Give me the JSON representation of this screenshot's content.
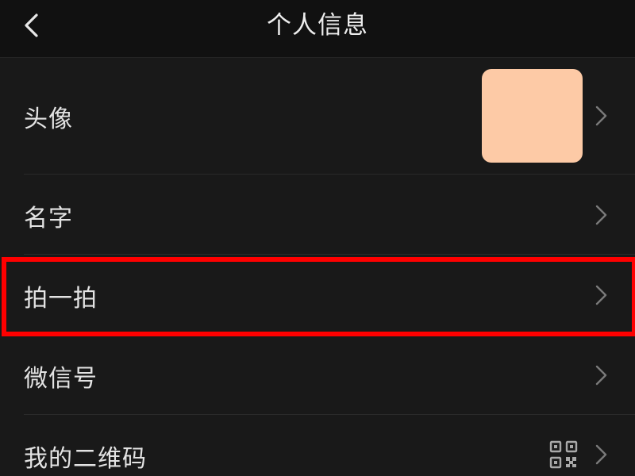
{
  "header": {
    "title": "个人信息",
    "back_icon": "chevron-left-icon"
  },
  "rows": [
    {
      "label": "头像",
      "trailing": "avatar-image"
    },
    {
      "label": "名字",
      "trailing": "chevron-right-icon"
    },
    {
      "label": "拍一拍",
      "trailing": "chevron-right-icon",
      "highlighted": true
    },
    {
      "label": "微信号",
      "trailing": "chevron-right-icon"
    },
    {
      "label": "我的二维码",
      "trailing": "qr-code-icon"
    }
  ],
  "colors": {
    "background": "#191919",
    "header_background": "#111111",
    "avatar_fill": "#fdcaa6",
    "highlight_border": "#ff0000",
    "text": "#e3e3e3"
  }
}
